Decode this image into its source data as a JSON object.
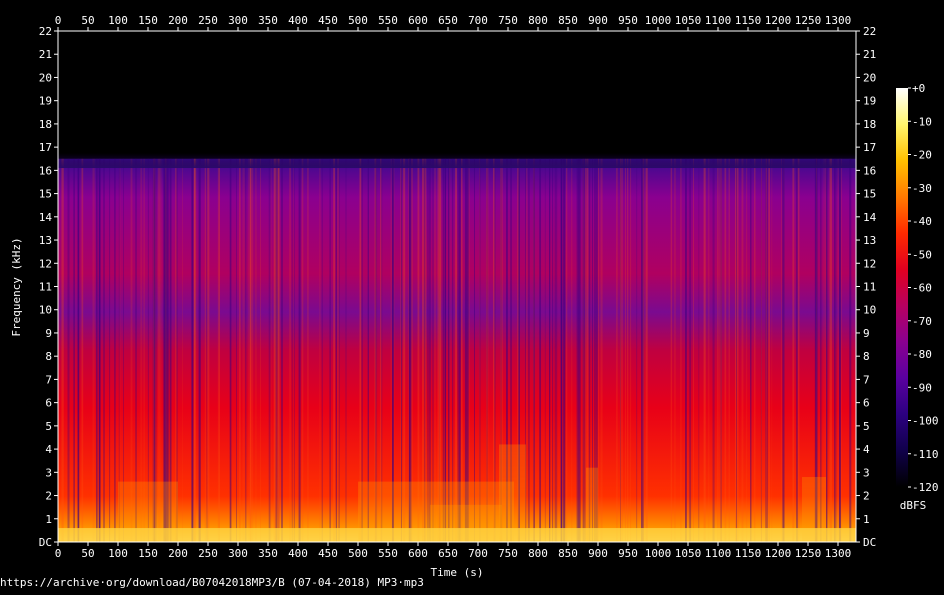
{
  "chart_data": {
    "type": "heatmap",
    "xlabel": "Time (s)",
    "ylabel": "Frequency (kHz)",
    "x_range": [
      0,
      1330
    ],
    "y_range": [
      0,
      22
    ],
    "x_ticks": [
      0,
      50,
      100,
      150,
      200,
      250,
      300,
      350,
      400,
      450,
      500,
      550,
      600,
      650,
      700,
      750,
      800,
      850,
      900,
      950,
      1000,
      1050,
      1100,
      1150,
      1200,
      1250,
      1300
    ],
    "y_ticks": [
      "DC",
      "1",
      "2",
      "3",
      "4",
      "5",
      "6",
      "7",
      "8",
      "9",
      "10",
      "11",
      "12",
      "13",
      "14",
      "15",
      "16",
      "17",
      "18",
      "19",
      "20",
      "21",
      "22"
    ],
    "colorbar": {
      "label": "dBFS",
      "range": [
        -120,
        0
      ],
      "ticks": [
        "+0",
        "-10",
        "-20",
        "-30",
        "-40",
        "-50",
        "-60",
        "-70",
        "-80",
        "-90",
        "-100",
        "-110",
        "-120"
      ],
      "colors": [
        "#ffffff",
        "#fff66e",
        "#ffc000",
        "#ff7a00",
        "#ff2a00",
        "#e00020",
        "#b80060",
        "#8a0090",
        "#5a00a0",
        "#2c0080",
        "#10004a",
        "#000000"
      ]
    },
    "frequency_cutoff_khz": 16.5
  },
  "footer": {
    "source_text": "https://archive·org/download/B07042018MP3/B (07-04-2018) MP3·mp3"
  }
}
